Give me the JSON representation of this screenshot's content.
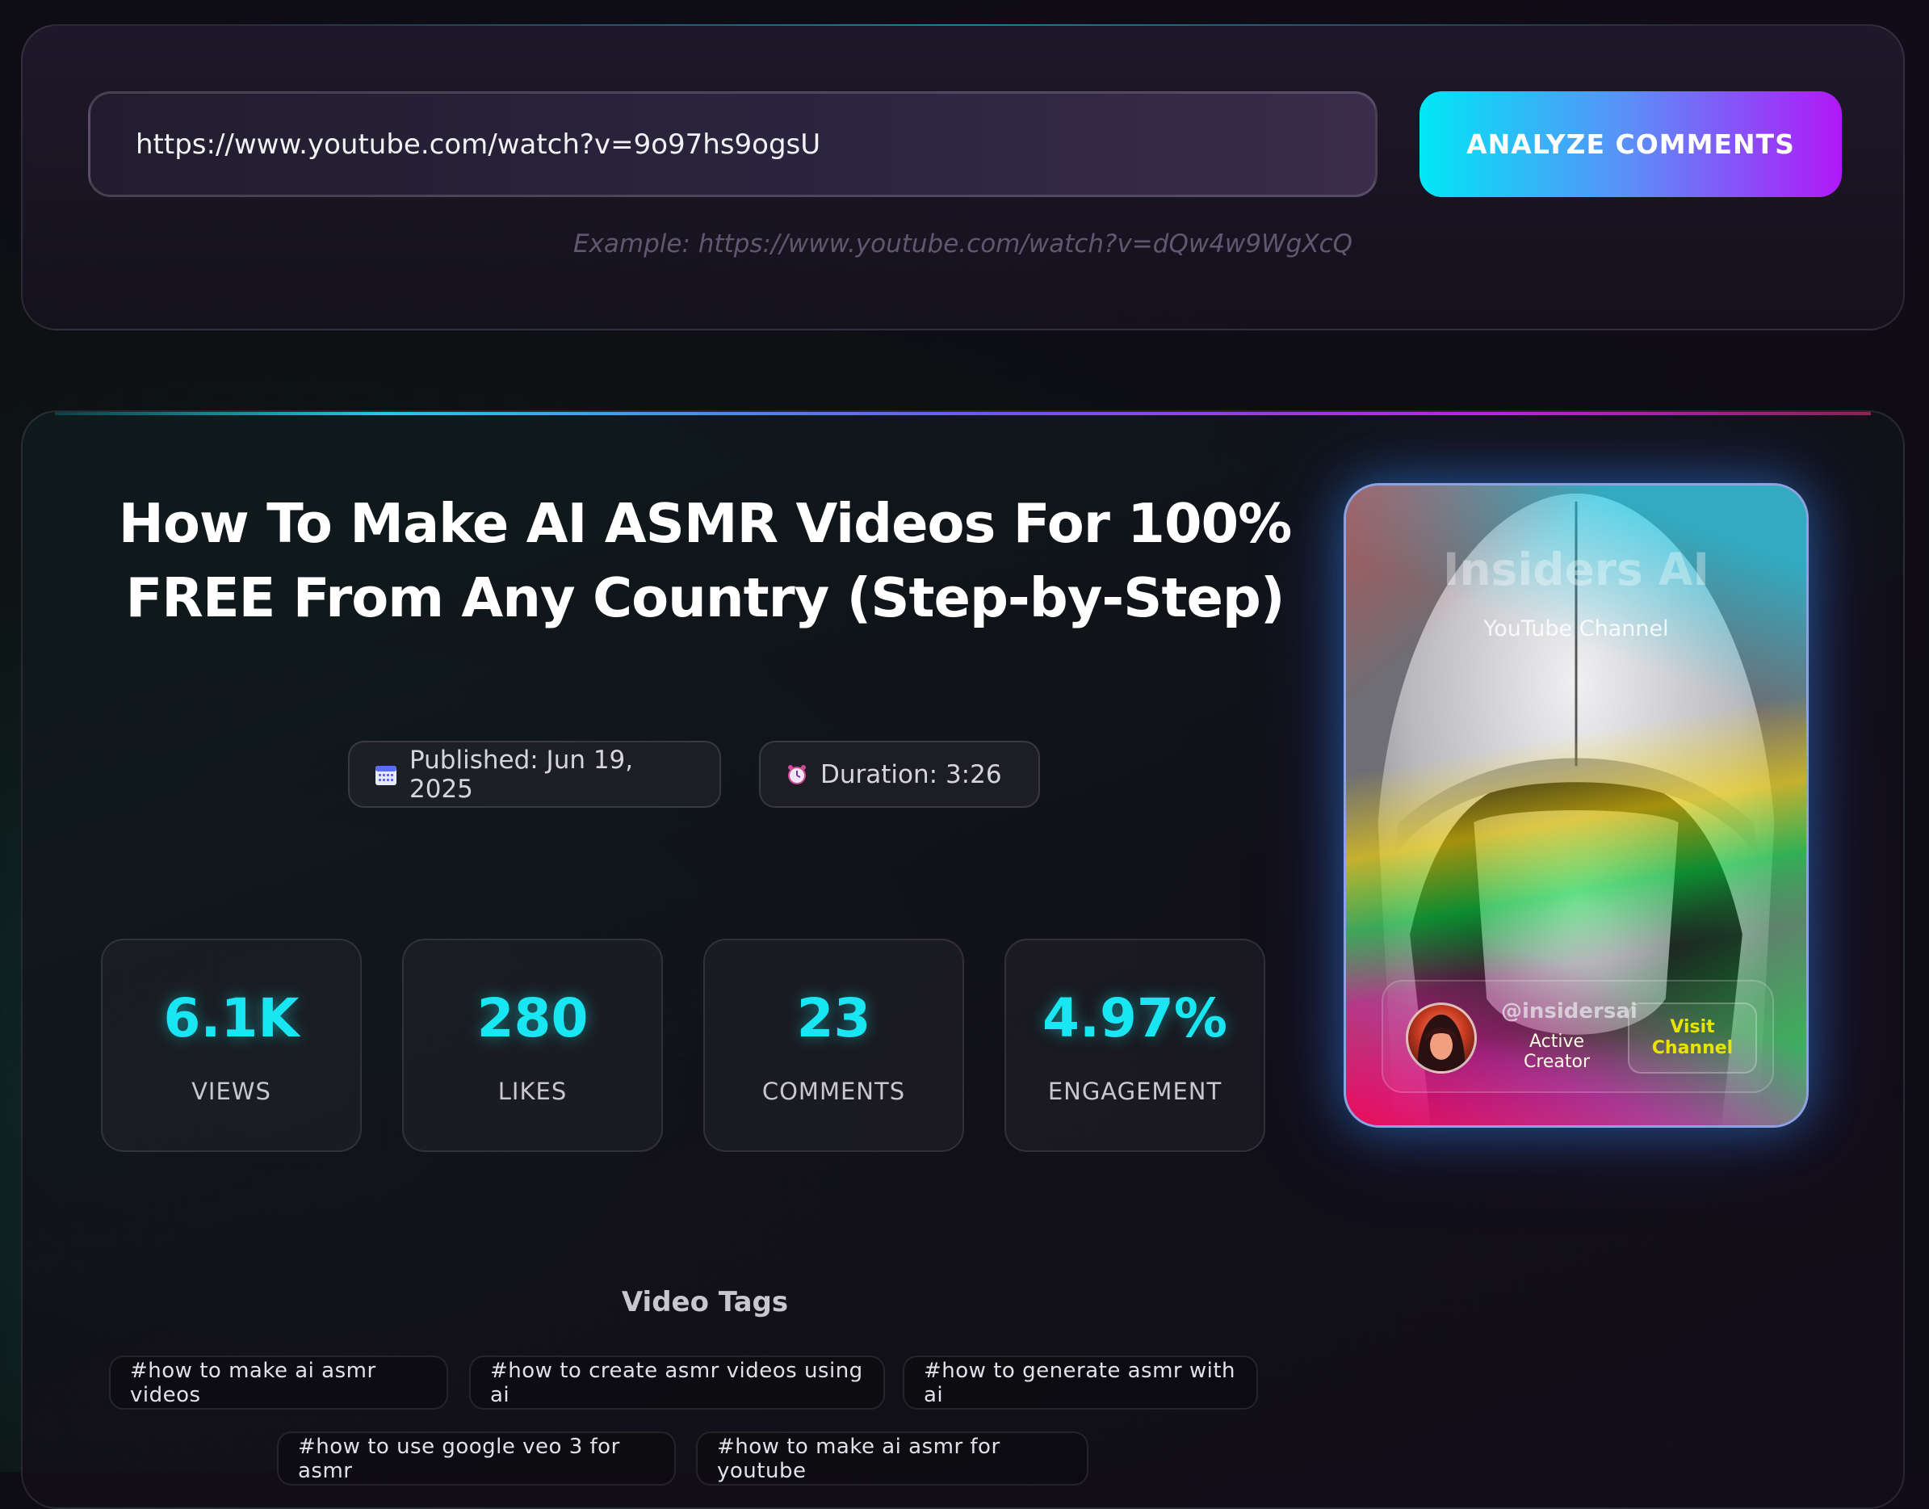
{
  "search": {
    "url_value": "https://www.youtube.com/watch?v=9o97hs9ogsU",
    "button_label": "ANALYZE COMMENTS",
    "example": "Example: https://www.youtube.com/watch?v=dQw4w9WgXcQ"
  },
  "video": {
    "title": "How To Make AI ASMR Videos For 100% FREE From Any Country (Step-by-Step)",
    "published": "Published: Jun 19, 2025",
    "duration": "Duration: 3:26",
    "stats": [
      {
        "value": "6.1K",
        "label": "VIEWS"
      },
      {
        "value": "280",
        "label": "LIKES"
      },
      {
        "value": "23",
        "label": "COMMENTS"
      },
      {
        "value": "4.97%",
        "label": "ENGAGEMENT"
      }
    ],
    "tags_heading": "Video Tags",
    "tags": [
      "#how to make ai asmr videos",
      "#how to create asmr videos using ai",
      "#how to generate asmr with ai",
      "#how to use google veo 3 for asmr",
      "#how to make ai asmr for youtube"
    ]
  },
  "channel": {
    "name": "Insiders AI",
    "subtitle": "YouTube Channel",
    "handle": "@insidersai",
    "status": "Active Creator",
    "visit_label": "Visit Channel"
  },
  "colors": {
    "accent_cyan": "#18e6f2",
    "button_start": "#00e7f5",
    "button_end": "#b118f7"
  },
  "icons": {
    "published": "calendar-icon",
    "duration": "clock-icon"
  }
}
